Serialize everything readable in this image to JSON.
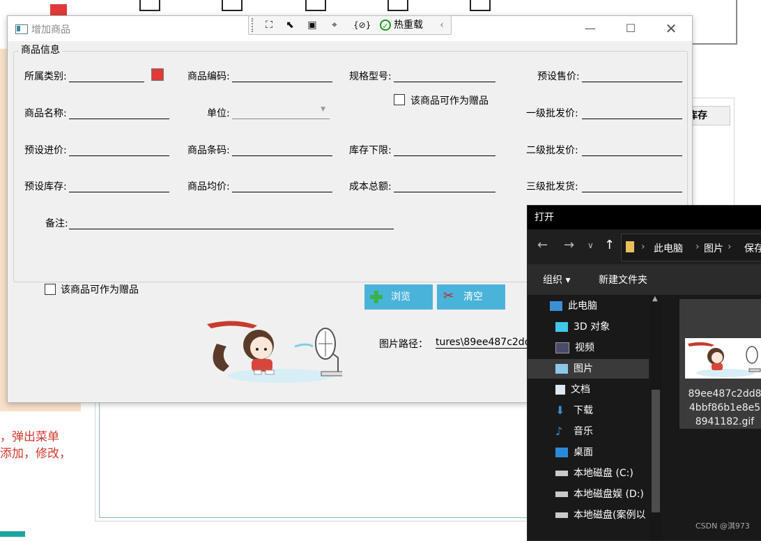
{
  "background": {
    "note_lines": [
      "，弹出菜单",
      "添加，修改，"
    ],
    "table_header_partial": "库存"
  },
  "dialog": {
    "title": "增加商品",
    "debug_toolbar": {
      "reload_label": "热重载",
      "braces": "{⊘}"
    },
    "group_title": "商品信息",
    "fields": {
      "category": "所属类别:",
      "code": "商品编码:",
      "spec": "规格型号:",
      "preset_price": "预设售价:",
      "name": "商品名称:",
      "unit": "单位:",
      "wholesale1": "一级批发价:",
      "preset_cost": "预设进价:",
      "barcode": "商品条码:",
      "stock_min": "库存下限:",
      "wholesale2": "二级批发价:",
      "preset_stock": "预设库存:",
      "avg_price": "商品均价:",
      "total_cost": "成本总额:",
      "wholesale3": "三级批发货:",
      "remark": "备注:"
    },
    "gift_checkbox_label": "该商品可作为赠品",
    "gift_checkbox_label_2": "该商品可作为赠品",
    "browse_label": "浏览",
    "clear_label": "清空",
    "image_path_label": "图片路径：",
    "image_path_value": "tures\\89ee487c2dd"
  },
  "file_dialog": {
    "title": "打开",
    "breadcrumb": [
      "此电脑",
      "图片",
      "保存"
    ],
    "organize_label": "组织 ▾",
    "new_folder_label": "新建文件夹",
    "tree": [
      {
        "label": "此电脑",
        "icon": "pc-icon"
      },
      {
        "label": "3D 对象",
        "icon": "cube-icon"
      },
      {
        "label": "视频",
        "icon": "video-icon"
      },
      {
        "label": "图片",
        "icon": "picture-icon",
        "selected": true
      },
      {
        "label": "文档",
        "icon": "document-icon"
      },
      {
        "label": "下载",
        "icon": "download-icon"
      },
      {
        "label": "音乐",
        "icon": "music-icon"
      },
      {
        "label": "桌面",
        "icon": "desktop-icon"
      },
      {
        "label": "本地磁盘 (C:)",
        "icon": "drive-icon"
      },
      {
        "label": "本地磁盘娱 (D:)",
        "icon": "drive-icon"
      },
      {
        "label": "本地磁盘(案例以",
        "icon": "drive-icon"
      }
    ],
    "file_name_lines": [
      "89ee487c2dd8",
      "4bbf86b1e8e5",
      "8941182.gif"
    ]
  },
  "watermark": "CSDN @淇973",
  "colors": {
    "button_bg": "#4ab3d9",
    "category_swatch": "#e03a3a",
    "file_dialog_bg": "#191919"
  }
}
